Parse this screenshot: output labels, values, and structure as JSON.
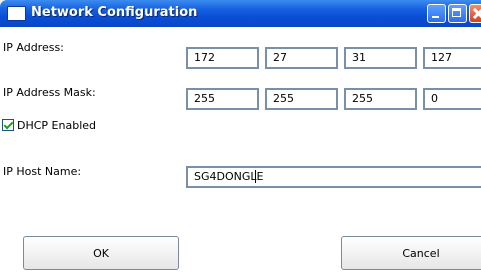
{
  "window": {
    "title": "Network Configuration"
  },
  "ip_address": {
    "label": "IP Address:",
    "octets": [
      "172",
      "27",
      "31",
      "127"
    ]
  },
  "ip_mask": {
    "label": "IP Address Mask:",
    "octets": [
      "255",
      "255",
      "255",
      "0"
    ]
  },
  "dhcp": {
    "label": "DHCP Enabled",
    "checked": true
  },
  "host_name": {
    "label": "IP Host Name:",
    "value": "SG4DONGLE"
  },
  "buttons": {
    "ok": "OK",
    "cancel": "Cancel"
  },
  "colors": {
    "titlebar": "#0a4fd6",
    "field_border": "#7a8fa8",
    "checkmark": "#21a121"
  },
  "icons": {
    "window": "window-icon",
    "minimize": "minimize-icon",
    "maximize": "maximize-icon",
    "close": "close-icon",
    "checkbox": "checkbox-checked-icon"
  }
}
